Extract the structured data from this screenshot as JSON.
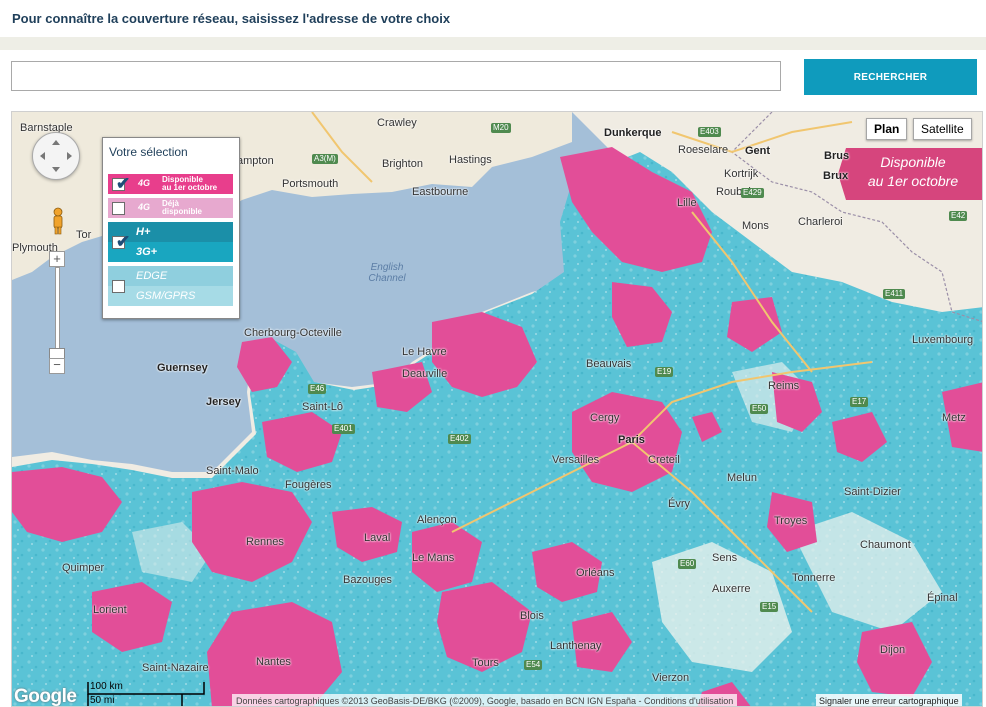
{
  "header": {
    "title": "Pour connaître la couverture réseau, saisissez l'adresse de votre choix"
  },
  "search": {
    "placeholder": "",
    "value": "",
    "button_label": "RECHERCHER"
  },
  "map": {
    "map_type": {
      "plan": "Plan",
      "satellite": "Satellite",
      "selected": "Plan"
    },
    "banner": {
      "line1": "Disponible",
      "line2": "au 1er octobre"
    },
    "legend": {
      "title": "Votre sélection",
      "items": [
        {
          "key": "4g-october",
          "tech": "4G",
          "label1": "Disponible",
          "label2": "au 1er octobre",
          "checked": true,
          "color": "#e83e8c"
        },
        {
          "key": "4g-now",
          "tech": "4G",
          "label1": "Déjà",
          "label2": "disponible",
          "checked": false,
          "color": "#e7a9cf"
        },
        {
          "key": "3g",
          "tech1": "H+",
          "tech2": "3G+",
          "checked": true,
          "color": "#19a6c0"
        },
        {
          "key": "edge",
          "tech1": "EDGE",
          "tech2": "GSM/GPRS",
          "checked": false,
          "color": "#a6dbe6"
        }
      ]
    },
    "scale": {
      "km": "100 km",
      "mi": "50 mi"
    },
    "logo": "Google",
    "attribution": "Données cartographiques ©2013 GeoBasis-DE/BKG (©2009), Google, basado en BCN IGN España - Conditions d'utilisation",
    "report_error": "Signaler une erreur cartographique",
    "colors": {
      "sea": "#a4bfd8",
      "land": "#f0ece3",
      "coverage_3g": "#5ac3d6",
      "coverage_4g": "#e24e98"
    },
    "places": [
      "Barnstaple",
      "Crawley",
      "Dunkerque",
      "Gent",
      "Brus",
      "Brux",
      "Roeselare",
      "Kortrijk",
      "Roubaix",
      "Charleroi",
      "Mons",
      "Lille",
      "ampton",
      "Brighton",
      "Hastings",
      "Portsmouth",
      "Eastbourne",
      "English Channel",
      "Plymouth",
      "Tor",
      "Guernsey",
      "Jersey",
      "Cherbourg-Octeville",
      "Le Havre",
      "Deauville",
      "Saint-Lô",
      "Saint-Malo",
      "Fougères",
      "Rennes",
      "Laval",
      "Le Mans",
      "Versailles",
      "Paris",
      "Cergy",
      "Creteil",
      "Beauvais",
      "Reims",
      "Troyes",
      "Chaumont",
      "Saint-Dizier",
      "Luxembourg",
      "Metz",
      "Auxerre",
      "Tours",
      "Nantes",
      "Saint-Nazaire",
      "Lorient",
      "Quimper",
      "Orléans",
      "Blois",
      "Dijon",
      "Bazouges",
      "Lanthenay",
      "Alençon",
      "Vierzon",
      "Évry",
      "Melun",
      "Sens",
      "Tonnerre",
      "Épinal"
    ],
    "roads": [
      "A3(M)",
      "M20",
      "E403",
      "E429",
      "E42",
      "E411",
      "E46",
      "E401",
      "E402",
      "E50",
      "E19",
      "E15",
      "E54",
      "E60",
      "E17"
    ]
  }
}
